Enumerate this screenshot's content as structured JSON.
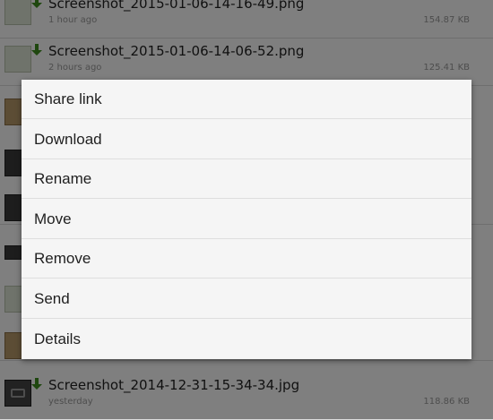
{
  "files": [
    {
      "name": "Screenshot_2015-01-06-14-16-49.png",
      "time": "1 hour ago",
      "size": "154.87 KB",
      "thumb": "img-thumbnail"
    },
    {
      "name": "Screenshot_2015-01-06-14-06-52.png",
      "time": "2 hours ago",
      "size": "125.41 KB",
      "thumb": "img-thumbnail"
    },
    {
      "name": "",
      "time": "",
      "size": "",
      "thumb": "photo-thumbnail"
    },
    {
      "name": "",
      "time": "",
      "size": "",
      "thumb": "dark-thumbnail"
    },
    {
      "name": "",
      "time": "",
      "size": "",
      "thumb": "dark-thumbnail"
    },
    {
      "name": "",
      "time": "",
      "size": "",
      "thumb": "dark-thumbnail"
    },
    {
      "name": "",
      "time": "",
      "size": "",
      "thumb": "img-thumbnail"
    },
    {
      "name": "",
      "time": "",
      "size": "",
      "thumb": "photo-thumbnail"
    },
    {
      "name": "Screenshot_2014-12-31-15-34-34.jpg",
      "time": "yesterday",
      "size": "118.86 KB",
      "thumb": "screenshot-thumbnail"
    }
  ],
  "download_icon": "download-arrow-icon",
  "download_icon_color": "#3f8f1f",
  "context_menu": {
    "items": [
      "Share link",
      "Download",
      "Rename",
      "Move",
      "Remove",
      "Send",
      "Details"
    ]
  },
  "colors": {
    "menu_background": "#f5f5f5",
    "scrim": "rgba(0,0,0,0.5)"
  }
}
